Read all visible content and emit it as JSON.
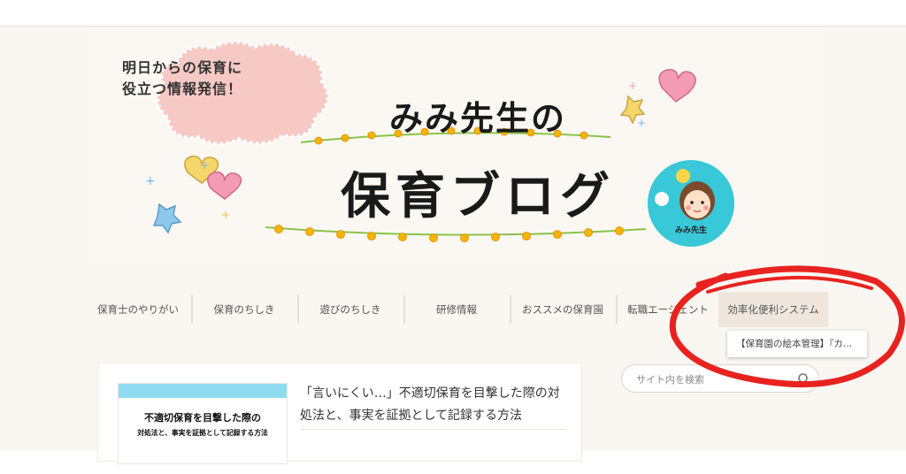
{
  "banner": {
    "bubble_line1": "明日からの保育に",
    "bubble_line2": "役立つ情報発信！",
    "title_line1": "みみ先生の",
    "title_line2": "保育ブログ",
    "avatar_label": "みみ先生"
  },
  "nav": {
    "items": [
      {
        "label": "保育士のやりがい"
      },
      {
        "label": "保育のちしき"
      },
      {
        "label": "遊びのちしき"
      },
      {
        "label": "研修情報"
      },
      {
        "label": "おススメの保育園"
      },
      {
        "label": "転職エージェント"
      },
      {
        "label": "効率化便利システム"
      }
    ],
    "dropdown_item": "【保育園の絵本管理】『カ…"
  },
  "article": {
    "thumb_line1": "不適切保育を目撃した際の",
    "thumb_line2": "対処法と、事実を証拠として記録する方法",
    "title": "「言いにくい…」不適切保育を目撃した際の対処法と、事実を証拠として記録する方法"
  },
  "search": {
    "placeholder": "サイト内を検索",
    "icon": "search-icon"
  },
  "colors": {
    "annotation": "#e8231f",
    "avatar_bg": "#38c8d8",
    "thumb_band": "#8fdcee",
    "bubble": "#f6c9c4"
  }
}
